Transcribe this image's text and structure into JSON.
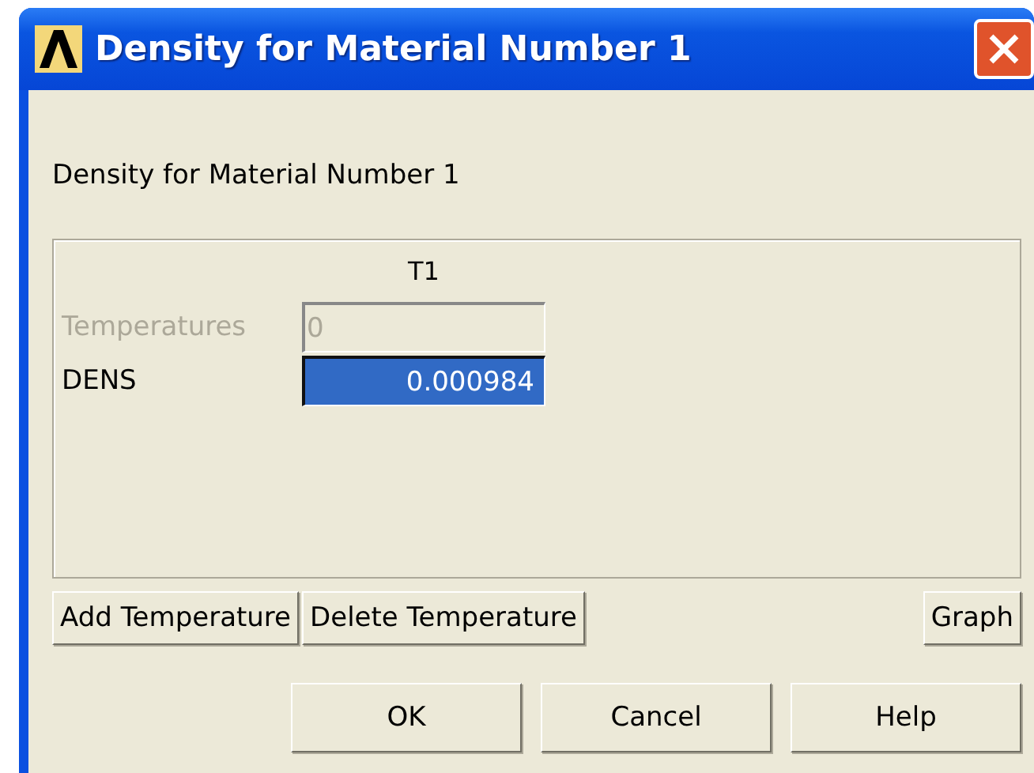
{
  "window": {
    "title": "Density for Material Number 1"
  },
  "heading": "Density for Material Number 1",
  "table": {
    "columns": [
      "T1"
    ],
    "rows": [
      {
        "label": "Temperatures",
        "value": "0",
        "disabled": true,
        "selected": false
      },
      {
        "label": "DENS",
        "value": "0.000984",
        "disabled": false,
        "selected": true
      }
    ]
  },
  "table_buttons": [
    {
      "label": "Add Temperature",
      "kind": "left"
    },
    {
      "label": "Delete Temperature",
      "kind": "left"
    },
    {
      "label": "Graph",
      "kind": "right"
    }
  ],
  "buttons": [
    "OK",
    "Cancel",
    "Help"
  ]
}
